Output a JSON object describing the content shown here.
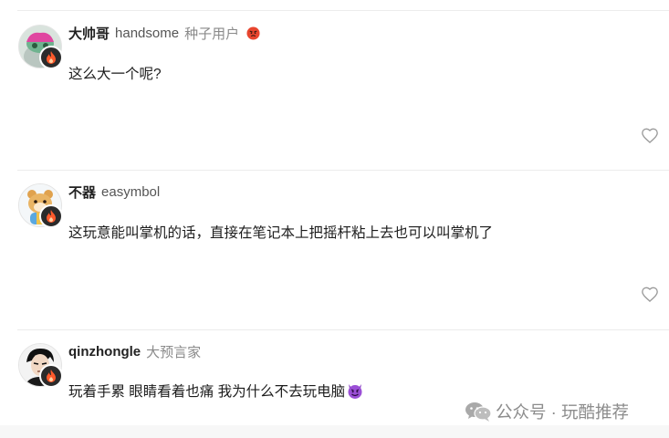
{
  "comments": [
    {
      "username": "大帅哥",
      "handle": "handsome",
      "level": "种子用户",
      "level_emoji": "angry-face-icon",
      "text": "这么大一个呢?",
      "has_emoji_suffix": false
    },
    {
      "username": "不器",
      "handle": "easymbol",
      "level": "",
      "text": "这玩意能叫掌机的话，直接在笔记本上把摇杆粘上去也可以叫掌机了",
      "has_emoji_suffix": false
    },
    {
      "username": "qinzhongle",
      "handle": "",
      "level": "大预言家",
      "text": "玩着手累 眼睛看着也痛 我为什么不去玩电脑",
      "has_emoji_suffix": true,
      "suffix_emoji": "smiling-imp-icon"
    }
  ],
  "watermark": {
    "icon": "wechat-icon",
    "text": "公众号 · 玩酷推荐"
  },
  "icons": {
    "like": "heart-outline-icon",
    "badge": "flame-icon"
  },
  "colors": {
    "divider": "#ececec",
    "badge_bg": "#2b2b2b",
    "flame": "#ff5a2c",
    "muted_text": "#8a8a8a"
  }
}
